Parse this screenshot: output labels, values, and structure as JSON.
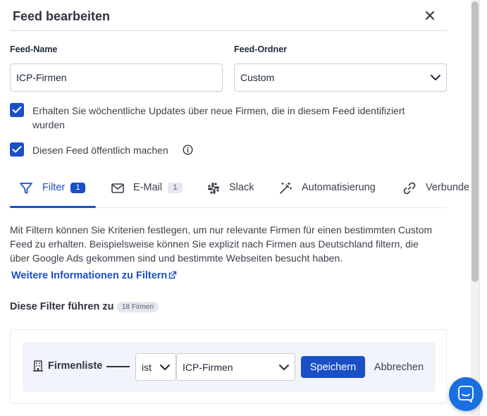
{
  "dialog": {
    "title": "Feed bearbeiten"
  },
  "form": {
    "name_label": "Feed-Name",
    "name_value": "ICP-Firmen",
    "folder_label": "Feed-Ordner",
    "folder_value": "Custom"
  },
  "checkboxes": [
    {
      "label": "Erhalten Sie wöchentliche Updates über neue Firmen, die in diesem Feed identifiziert wurden",
      "checked": true
    },
    {
      "label": "Diesen Feed öffentlich machen",
      "checked": true
    }
  ],
  "tabs": [
    {
      "label": "Filter",
      "badge": "1",
      "active": true,
      "icon": "filter-icon"
    },
    {
      "label": "E-Mail",
      "badge": "1",
      "active": false,
      "icon": "mail-icon"
    },
    {
      "label": "Slack",
      "active": false,
      "icon": "slack-icon"
    },
    {
      "label": "Automatisierung",
      "active": false,
      "icon": "magic-wand-icon"
    },
    {
      "label": "Verbunde",
      "active": false,
      "icon": "link-icon"
    }
  ],
  "filter_section": {
    "description": "Mit Filtern können Sie Kriterien festlegen, um nur relevante Firmen für einen bestimmten Custom Feed zu erhalten. Beispielsweise können Sie explizit nach Firmen aus Deutschland filtern, die über Google Ads gekommen sind und bestimmte Webseiten besucht haben.",
    "more_link": "Weitere Informationen zu Filtern",
    "result_label": "Diese Filter führen zu",
    "result_count": "18 Firmen"
  },
  "filter_row": {
    "field_label": "Firmenliste",
    "operator": "ist",
    "value": "ICP-Firmen",
    "save_label": "Speichern",
    "cancel_label": "Abbrechen"
  },
  "colors": {
    "primary": "#1a4fc6",
    "chat": "#1a6fe0",
    "filter_row_bg": "#f1f4fa"
  }
}
